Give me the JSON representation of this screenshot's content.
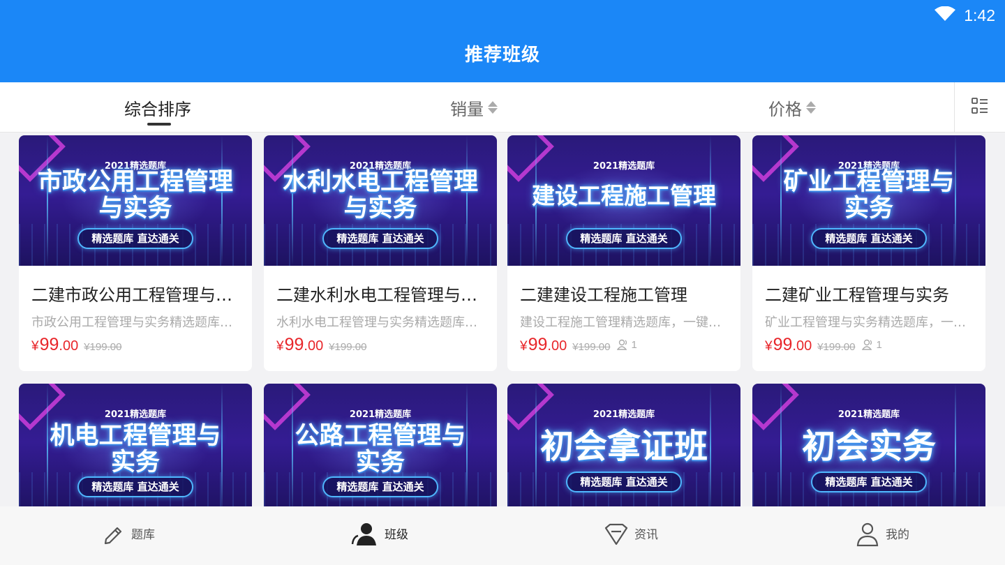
{
  "status": {
    "time": "1:42",
    "wifi_icon": "wifi-icon"
  },
  "header": {
    "title": "推荐班级"
  },
  "sort": {
    "comprehensive": "综合排序",
    "sales": "销量",
    "price": "价格",
    "layout_toggle_icon": "list-grid-icon"
  },
  "courses": [
    {
      "banner_top": "2021精选题库",
      "banner_title": "市政公用工程管理与实务",
      "banner_pill": "精选题库 直达通关",
      "title": "二建市政公用工程管理与实务",
      "desc": "市政公用工程管理与实务精选题库，一键通关",
      "price_int": "99",
      "price_dec": ".00",
      "currency": "¥",
      "old_price": "¥199.00",
      "enrolled": ""
    },
    {
      "banner_top": "2021精选题库",
      "banner_title": "水利水电工程管理与实务",
      "banner_pill": "精选题库 直达通关",
      "title": "二建水利水电工程管理与实务",
      "desc": "水利水电工程管理与实务精选题库，一键通关",
      "price_int": "99",
      "price_dec": ".00",
      "currency": "¥",
      "old_price": "¥199.00",
      "enrolled": ""
    },
    {
      "banner_top": "2021精选题库",
      "banner_title": "建设工程施工管理",
      "banner_pill": "精选题库 直达通关",
      "title": "二建建设工程施工管理",
      "desc": "建设工程施工管理精选题库，一键通关",
      "price_int": "99",
      "price_dec": ".00",
      "currency": "¥",
      "old_price": "¥199.00",
      "enrolled": "1"
    },
    {
      "banner_top": "2021精选题库",
      "banner_title": "矿业工程管理与实务",
      "banner_pill": "精选题库 直达通关",
      "title": "二建矿业工程管理与实务",
      "desc": "矿业工程管理与实务精选题库，一键通关",
      "price_int": "99",
      "price_dec": ".00",
      "currency": "¥",
      "old_price": "¥199.00",
      "enrolled": "1"
    },
    {
      "banner_top": "2021精选题库",
      "banner_title": "机电工程管理与实务",
      "banner_pill": "精选题库 直达通关"
    },
    {
      "banner_top": "2021精选题库",
      "banner_title": "公路工程管理与实务",
      "banner_pill": "精选题库 直达通关"
    },
    {
      "banner_top": "2021精选题库",
      "banner_title": "初会拿证班",
      "banner_pill": "精选题库 直达通关"
    },
    {
      "banner_top": "2021精选题库",
      "banner_title": "初会实务",
      "banner_pill": "精选题库 直达通关"
    }
  ],
  "tabbar": [
    {
      "label": "题库",
      "icon": "pencil-icon",
      "active": false
    },
    {
      "label": "班级",
      "icon": "class-people-icon",
      "active": true
    },
    {
      "label": "资讯",
      "icon": "diamond-icon",
      "active": false
    },
    {
      "label": "我的",
      "icon": "user-icon",
      "active": false
    }
  ],
  "colors": {
    "accent": "#1b87f7",
    "price": "#e8262a",
    "banner_bg": "#341c93"
  }
}
